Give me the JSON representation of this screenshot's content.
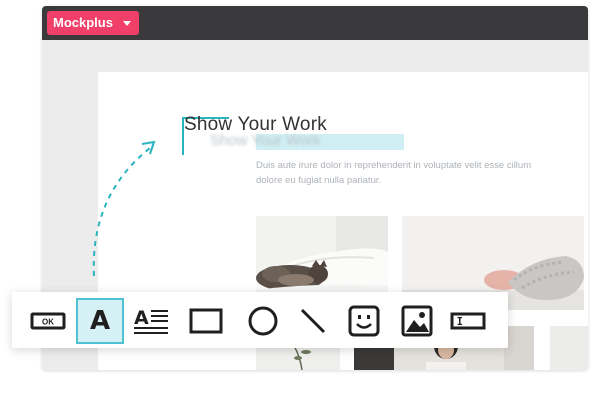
{
  "brand": {
    "label": "Mockplus"
  },
  "page": {
    "title": "Show Your Work",
    "ghost_title": "Show Your Work",
    "body": "Duis aute irure dolor in reprehenderit in voluptate velit esse cillum dolore eu fugiat nulla pariatur."
  },
  "toolbar": {
    "tools": [
      {
        "name": "button-tool",
        "label": "OK",
        "icon": "button-icon"
      },
      {
        "name": "text-tool",
        "label": "A",
        "icon": "text-icon",
        "active": true
      },
      {
        "name": "paragraph-tool",
        "label": "A",
        "icon": "paragraph-icon"
      },
      {
        "name": "rectangle-tool",
        "icon": "rectangle-icon"
      },
      {
        "name": "circle-tool",
        "icon": "circle-icon"
      },
      {
        "name": "line-tool",
        "icon": "line-icon"
      },
      {
        "name": "emoji-tool",
        "icon": "smiley-icon"
      },
      {
        "name": "image-tool",
        "icon": "image-icon"
      },
      {
        "name": "input-tool",
        "icon": "text-input-icon"
      }
    ]
  },
  "colors": {
    "brand": "#f0406a",
    "accent": "#2bb3c0",
    "topbar": "#3a3a3c",
    "active_tool_bg": "#d6f1f6"
  }
}
